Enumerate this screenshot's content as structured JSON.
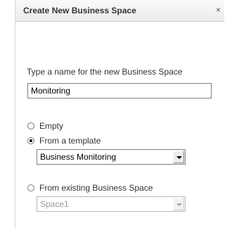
{
  "dialog": {
    "title": "Create New Business Space",
    "close_glyph": "×"
  },
  "name_prompt": "Type a name for the new Business Space",
  "name_value": "Monitoring",
  "options": {
    "empty_label": "Empty",
    "template_label": "From a template",
    "template_selected": "Business Monitoring",
    "existing_label": "From existing Business Space",
    "existing_selected": "Space1"
  },
  "selected_option": "From a template"
}
